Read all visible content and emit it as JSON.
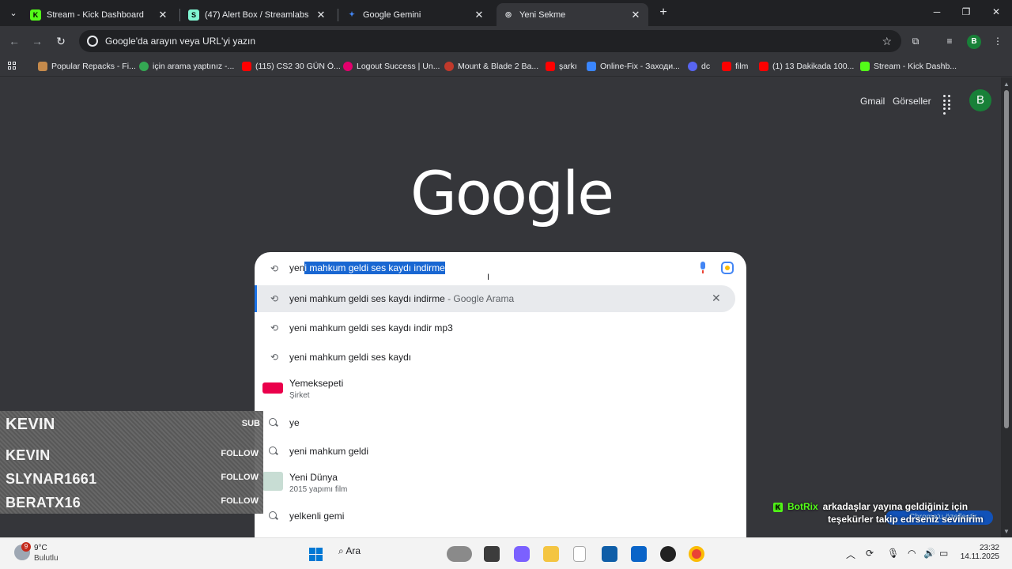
{
  "tabs": [
    {
      "title": "Stream - Kick Dashboard",
      "fav_color": "#53fc18",
      "fav_glyph": "K"
    },
    {
      "title": "(47) Alert Box / Streamlabs",
      "fav_color": "#80f5d2",
      "fav_glyph": "S"
    },
    {
      "title": "Google Gemini",
      "fav_color": "#4285f4",
      "fav_glyph": "✦"
    },
    {
      "title": "Yeni Sekme",
      "fav_color": "#9aa0a6",
      "fav_glyph": "◎"
    }
  ],
  "toolbar": {
    "omnibox_placeholder": "Google'da arayın veya URL'yi yazın",
    "profile_letter": "B"
  },
  "bookmarks": [
    {
      "label": "Popular Repacks - Fi...",
      "color": "#c58a4b"
    },
    {
      "label": "için arama yaptınız -...",
      "color": "#ea4335"
    },
    {
      "label": "(115) CS2 30 GÜN Ö...",
      "color": "#ff0000"
    },
    {
      "label": "Logout Success | Un...",
      "color": "#e3006d"
    },
    {
      "label": "Mount & Blade 2 Ba...",
      "color": "#c0392b"
    },
    {
      "label": "şarkı",
      "color": "#ff0000"
    },
    {
      "label": "Online-Fix - Заходи...",
      "color": "#3a86ff"
    },
    {
      "label": "dc",
      "color": "#5865f2"
    },
    {
      "label": "film",
      "color": "#ff0000"
    },
    {
      "label": "(1) 13 Dakikada 100...",
      "color": "#ff0000"
    },
    {
      "label": "Stream - Kick Dashb...",
      "color": "#53fc18"
    }
  ],
  "page": {
    "gmail_label": "Gmail",
    "images_label": "Görseller",
    "avatar_letter": "B",
    "logo_text": "Google"
  },
  "search": {
    "typed": "yeni",
    "typed_visible": "yen",
    "selected_completion": "i mahkum geldi ses kaydı indirme",
    "suggestions": [
      {
        "text": "yeni mahkum geldi ses kaydı indirme",
        "suffix": " - Google Arama",
        "type": "history",
        "highlighted": true
      },
      {
        "text": "yeni mahkum geldi ses kaydı indir mp3",
        "type": "history"
      },
      {
        "text": "yeni mahkum geldi ses kaydı",
        "type": "history"
      },
      {
        "text": "Yemeksepeti",
        "sub": "Şirket",
        "type": "entity",
        "img_color": "#ea004b"
      },
      {
        "text": "ye",
        "type": "search"
      },
      {
        "text": "yeni mahkum geldi",
        "type": "search"
      },
      {
        "text": "Yeni Dünya",
        "sub": "2015 yapımı film",
        "type": "entity",
        "img_color": "#c8ddd4"
      },
      {
        "text": "yelkenli gemi",
        "type": "search"
      }
    ]
  },
  "overlay": {
    "header_name": "KEVIN",
    "header_tag": "SUB",
    "rows": [
      {
        "name": "KEVIN",
        "tag": "FOLLOW"
      },
      {
        "name": "SLYNAR1661",
        "tag": "FOLLOW"
      },
      {
        "name": "BERATX16",
        "tag": "FOLLOW"
      }
    ]
  },
  "botrix": {
    "brand": "BotRix",
    "line1": "arkadaşlar yayına geldiğiniz için",
    "line2": "teşekürler takip edrseniz sevinirim",
    "chrome_pill": "Chrome'u özelleştir"
  },
  "taskbar": {
    "temp": "9°C",
    "condition": "Bulutlu",
    "weather_badge": "9",
    "search_label": "Ara",
    "time": "23:32",
    "date": "14.11.2025"
  },
  "colors": {
    "accent_blue": "#1a73e8",
    "selection": "#1967d2",
    "kick_green": "#53fc18"
  }
}
